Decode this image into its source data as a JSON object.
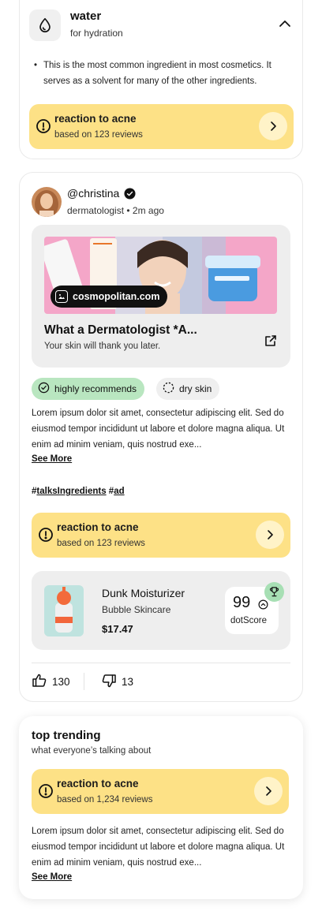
{
  "ingredient": {
    "name": "water",
    "subtitle": "for hydration",
    "icon": "droplet-icon",
    "description": "This is the most common ingredient in most cosmetics. It serves as a solvent for many of the other ingredients.",
    "reaction": {
      "title": "reaction to acne",
      "subtitle": "based on 123 reviews"
    }
  },
  "post": {
    "username": "@christina",
    "meta": "dermatologist • 2m ago",
    "article": {
      "source": "cosmopolitan.com",
      "title": "What a Dermatologist *A...",
      "subtitle": "Your skin will thank you later."
    },
    "tags": [
      "highly recommends",
      "dry skin"
    ],
    "body": "Lorem ipsum dolor sit amet, consectetur adipiscing elit. Sed do eiusmod tempor incididunt ut labore et dolore magna aliqua. Ut enim ad minim veniam, quis nostrud exe...",
    "see_more": "See More",
    "hashtags": [
      "talksIngredients",
      "ad"
    ],
    "reaction": {
      "title": "reaction to acne",
      "subtitle": "based on 123 reviews"
    },
    "product": {
      "name": "Dunk Moisturizer",
      "brand": "Bubble Skincare",
      "price": "$17.47",
      "score": "99",
      "score_label": "dotScore"
    },
    "likes": "130",
    "dislikes": "13"
  },
  "trending": {
    "title": "top trending",
    "subtitle": "what everyone’s talking about",
    "reaction": {
      "title": "reaction to acne",
      "subtitle": "based on 1,234 reviews"
    },
    "body": "Lorem ipsum dolor sit amet, consectetur adipiscing elit. Sed do eiusmod tempor incididunt ut labore et dolore magna aliqua. Ut enim ad minim veniam, quis nostrud exe...",
    "see_more": "See More"
  },
  "colors": {
    "reaction_bg": "#fde186",
    "tag_green": "#b9e6c0",
    "card_gray": "#eeeeee"
  }
}
